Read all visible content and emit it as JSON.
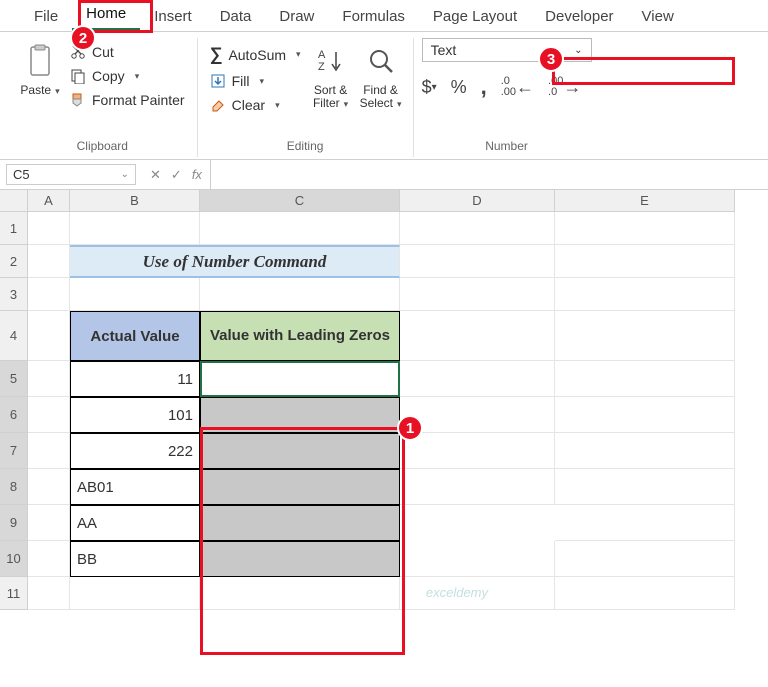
{
  "tabs": [
    "File",
    "Home",
    "Insert",
    "Data",
    "Draw",
    "Formulas",
    "Page Layout",
    "Developer",
    "View"
  ],
  "active_tab": "Home",
  "ribbon": {
    "clipboard": {
      "paste": "Paste",
      "cut": "Cut",
      "copy": "Copy",
      "format_painter": "Format Painter",
      "label": "Clipboard"
    },
    "editing": {
      "autosum": "AutoSum",
      "fill": "Fill",
      "clear": "Clear",
      "sort": "Sort & Filter",
      "find": "Find & Select",
      "label": "Editing"
    },
    "number": {
      "format": "Text",
      "label": "Number"
    }
  },
  "namebox": "C5",
  "sheet": {
    "columns": [
      "A",
      "B",
      "C",
      "D",
      "E"
    ],
    "rows": [
      "1",
      "2",
      "3",
      "4",
      "5",
      "6",
      "7",
      "8",
      "9",
      "10",
      "11"
    ],
    "title": "Use of Number Command",
    "header1": "Actual Value",
    "header2": "Value with Leading Zeros",
    "data_b": [
      "11",
      "101",
      "222",
      "AB01",
      "AA",
      "BB"
    ]
  },
  "markers": {
    "m1": "1",
    "m2": "2",
    "m3": "3"
  },
  "watermark": "exceldemy"
}
